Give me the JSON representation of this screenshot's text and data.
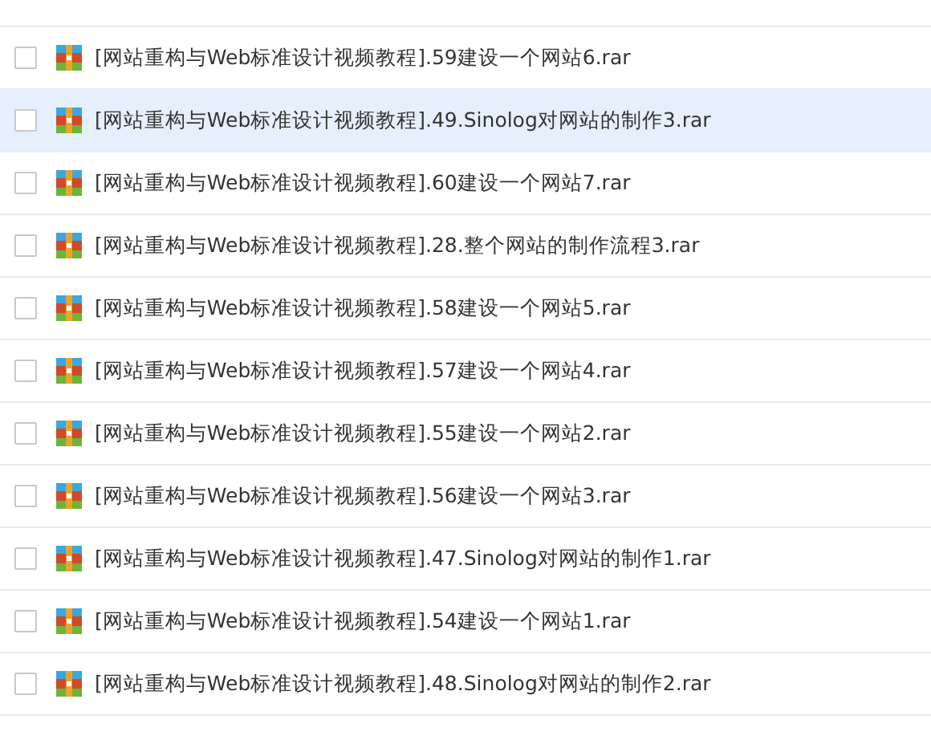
{
  "files": [
    {
      "name": "[网站重构与Web标准设计视频教程].59建设一个网站6.rar",
      "checked": false,
      "highlighted": false
    },
    {
      "name": "[网站重构与Web标准设计视频教程].49.Sinolog对网站的制作3.rar",
      "checked": false,
      "highlighted": true
    },
    {
      "name": "[网站重构与Web标准设计视频教程].60建设一个网站7.rar",
      "checked": false,
      "highlighted": false
    },
    {
      "name": "[网站重构与Web标准设计视频教程].28.整个网站的制作流程3.rar",
      "checked": false,
      "highlighted": false
    },
    {
      "name": "[网站重构与Web标准设计视频教程].58建设一个网站5.rar",
      "checked": false,
      "highlighted": false
    },
    {
      "name": "[网站重构与Web标准设计视频教程].57建设一个网站4.rar",
      "checked": false,
      "highlighted": false
    },
    {
      "name": "[网站重构与Web标准设计视频教程].55建设一个网站2.rar",
      "checked": false,
      "highlighted": false
    },
    {
      "name": "[网站重构与Web标准设计视频教程].56建设一个网站3.rar",
      "checked": false,
      "highlighted": false
    },
    {
      "name": "[网站重构与Web标准设计视频教程].47.Sinolog对网站的制作1.rar",
      "checked": false,
      "highlighted": false
    },
    {
      "name": "[网站重构与Web标准设计视频教程].54建设一个网站1.rar",
      "checked": false,
      "highlighted": false
    },
    {
      "name": "[网站重构与Web标准设计视频教程].48.Sinolog对网站的制作2.rar",
      "checked": false,
      "highlighted": false
    }
  ]
}
